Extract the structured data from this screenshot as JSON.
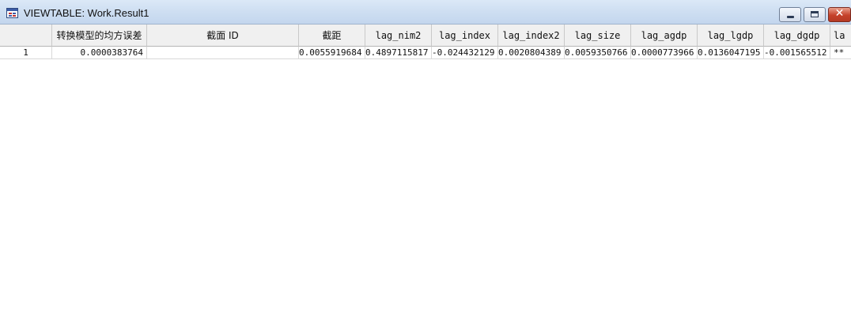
{
  "window": {
    "title": "VIEWTABLE: Work.Result1",
    "buttons": {
      "minimize": "minimize",
      "maximize": "maximize",
      "close": "close"
    }
  },
  "table": {
    "columns": [
      "",
      "转换模型的均方误差",
      "截面 ID",
      "截距",
      "lag_nim2",
      "lag_index",
      "lag_index2",
      "lag_size",
      "lag_agdp",
      "lag_lgdp",
      "lag_dgdp",
      "la"
    ],
    "rows": [
      {
        "cells": [
          "1",
          "0.0000383764",
          "",
          "0.0055919684",
          "0.4897115817",
          "-0.024432129",
          "0.0020804389",
          "0.0059350766",
          "0.0000773966",
          "0.0136047195",
          "-0.001565512",
          "**"
        ]
      }
    ]
  }
}
